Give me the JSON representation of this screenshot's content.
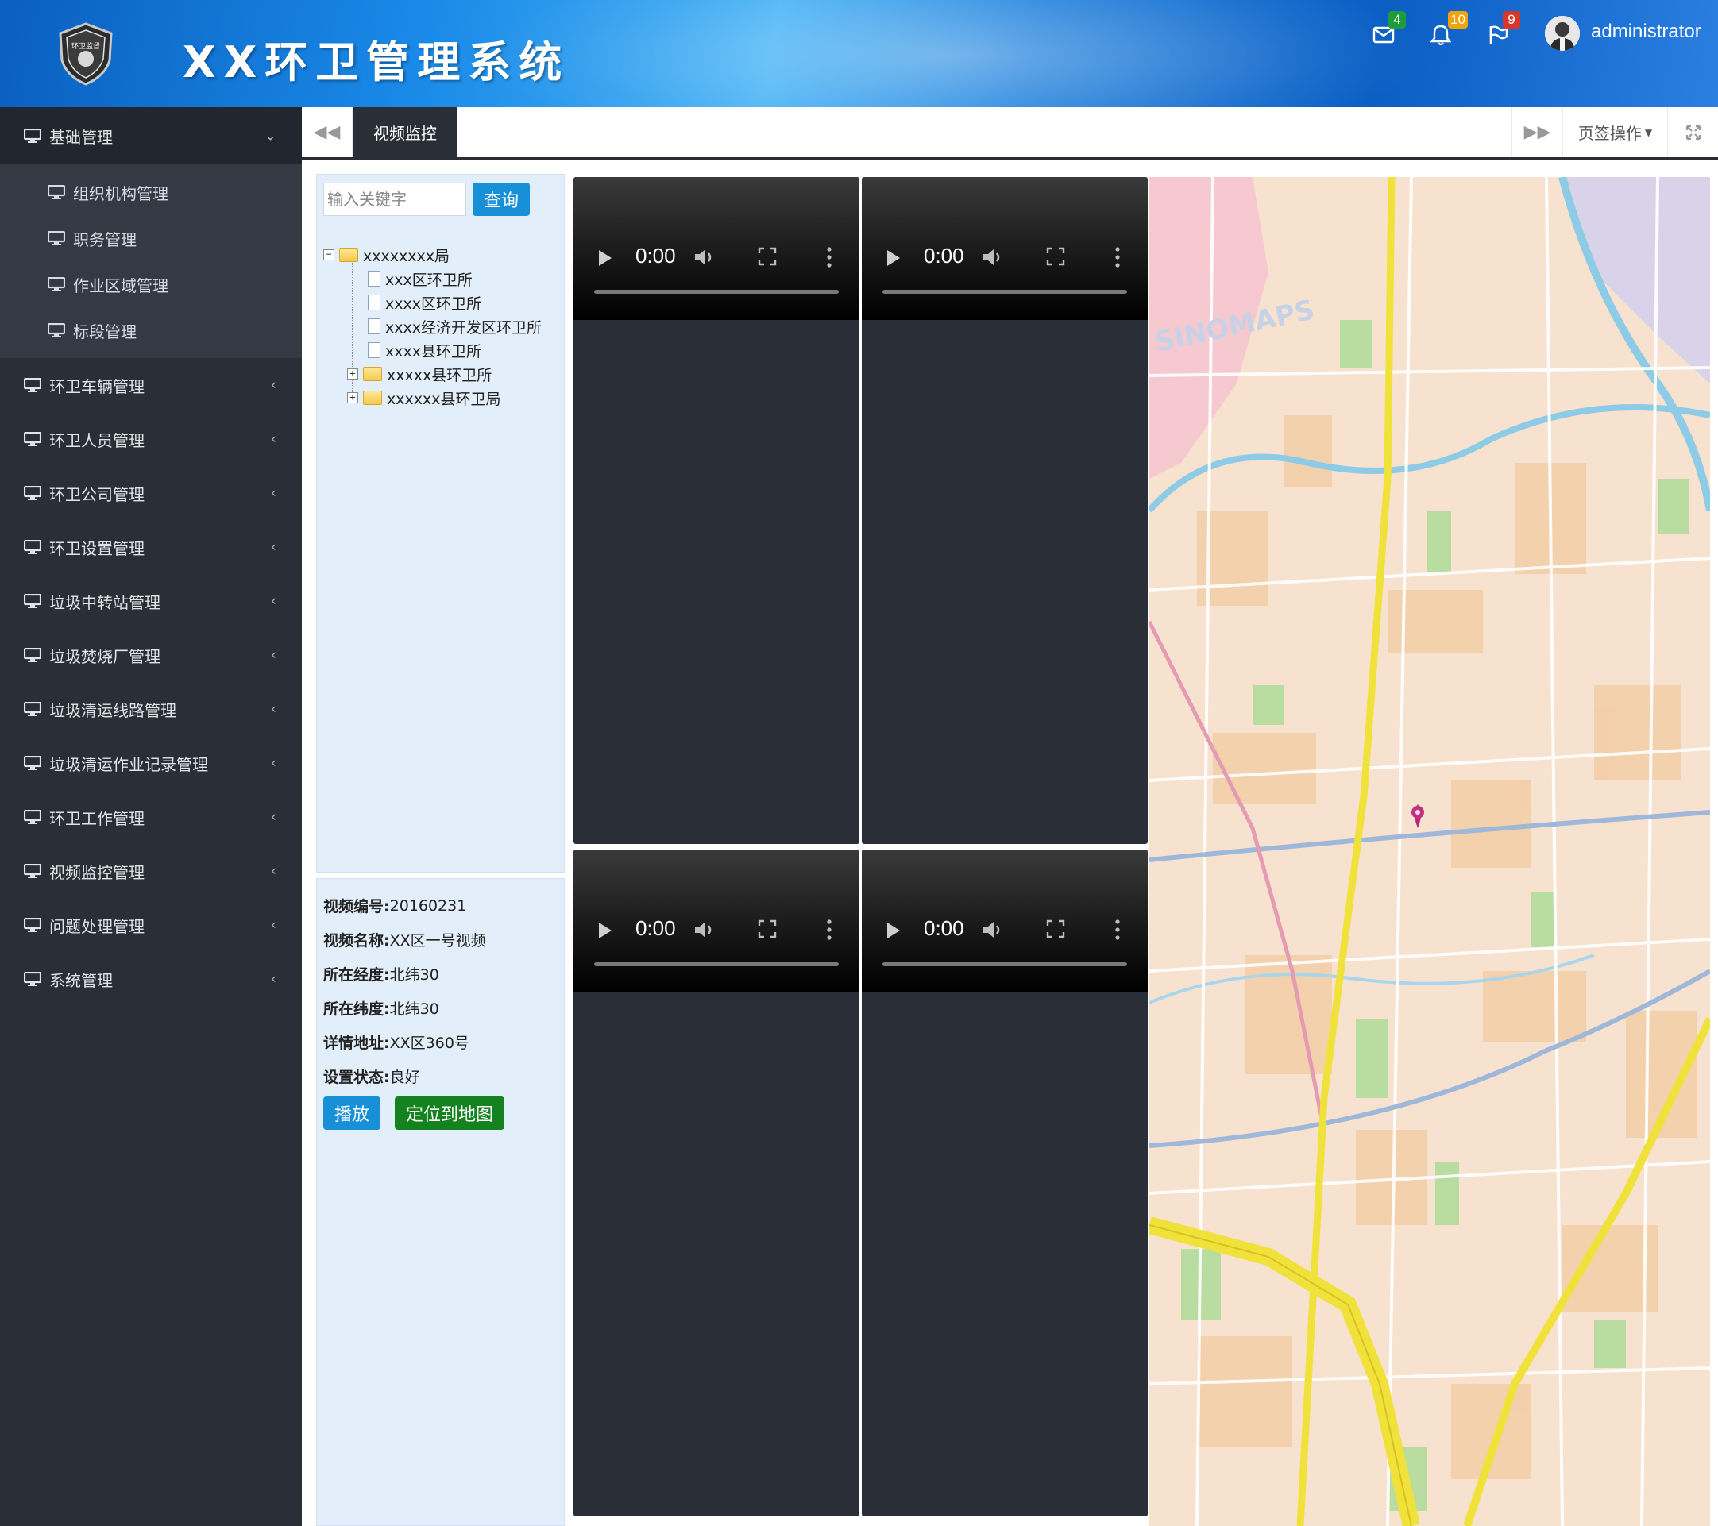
{
  "header": {
    "app_title": "XX环卫管理系统",
    "logo_text": "环卫监督",
    "username": "administrator",
    "badges": {
      "mail": "4",
      "bell": "10",
      "flag": "9"
    },
    "colors": {
      "mail_badge": "#1c9d3a",
      "bell_badge": "#f0a30a",
      "flag_badge": "#d9362b"
    }
  },
  "sidebar": {
    "items": [
      {
        "label": "基础管理",
        "expanded": true,
        "children": [
          "组织机构管理",
          "职务管理",
          "作业区域管理",
          "标段管理"
        ]
      },
      {
        "label": "环卫车辆管理"
      },
      {
        "label": "环卫人员管理"
      },
      {
        "label": "环卫公司管理"
      },
      {
        "label": "环卫设置管理"
      },
      {
        "label": "垃圾中转站管理"
      },
      {
        "label": "垃圾焚烧厂管理"
      },
      {
        "label": "垃圾清运线路管理"
      },
      {
        "label": "垃圾清运作业记录管理"
      },
      {
        "label": "环卫工作管理"
      },
      {
        "label": "视频监控管理"
      },
      {
        "label": "问题处理管理"
      },
      {
        "label": "系统管理"
      }
    ]
  },
  "tabs": {
    "active_tab": "视频监控",
    "ops_label": "页签操作"
  },
  "search": {
    "placeholder": "输入关键字",
    "button": "查询"
  },
  "tree": {
    "root": "xxxxxxxx局",
    "children": [
      {
        "label": "xxx区环卫所",
        "type": "file"
      },
      {
        "label": "xxxx区环卫所",
        "type": "file"
      },
      {
        "label": "xxxx经济开发区环卫所",
        "type": "file"
      },
      {
        "label": "xxxx县环卫所",
        "type": "file"
      },
      {
        "label": "xxxxx县环卫所",
        "type": "folder"
      },
      {
        "label": "xxxxxx县环卫局",
        "type": "folder"
      }
    ]
  },
  "info": {
    "video_no_label": "视频编号:",
    "video_no": "20160231",
    "video_name_label": "视频名称:",
    "video_name": "XX区一号视频",
    "lng_label": "所在经度:",
    "lng": "北纬30",
    "lat_label": "所在纬度:",
    "lat": "北纬30",
    "address_label": "详情地址:",
    "address": "XX区360号",
    "status_label": "设置状态:",
    "status": "良好",
    "play_button": "播放",
    "locate_button": "定位到地图"
  },
  "videos": [
    {
      "time": "0:00"
    },
    {
      "time": "0:00"
    },
    {
      "time": "0:00"
    },
    {
      "time": "0:00"
    }
  ],
  "map": {
    "watermark": "SINOMAPS"
  }
}
